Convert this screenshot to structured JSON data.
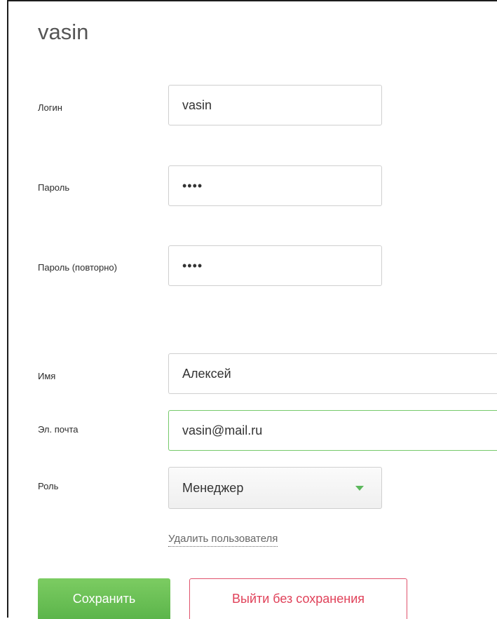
{
  "form": {
    "title": "vasin",
    "login": {
      "label": "Логин",
      "value": "vasin"
    },
    "password": {
      "label": "Пароль",
      "value": "••••"
    },
    "password_repeat": {
      "label": "Пароль (повторно)",
      "value": "••••"
    },
    "name": {
      "label": "Имя",
      "value": "Алексей"
    },
    "email": {
      "label": "Эл. почта",
      "value": "vasin@mail.ru"
    },
    "role": {
      "label": "Роль",
      "value": "Менеджер"
    },
    "delete_link": "Удалить пользователя"
  },
  "actions": {
    "save_label": "Сохранить",
    "exit_label": "Выйти без сохранения"
  },
  "colors": {
    "accent_green": "#5cb85c",
    "danger_red": "#e04159",
    "focus_border": "#76c96a"
  },
  "icons": {
    "role_dropdown": "chevron-down-icon"
  }
}
